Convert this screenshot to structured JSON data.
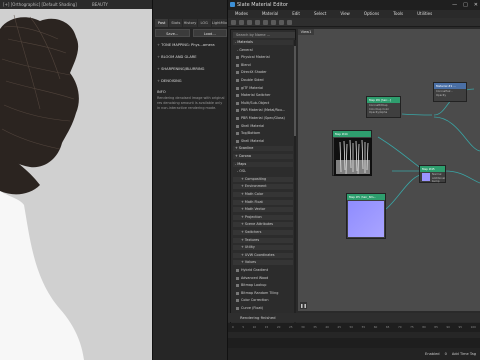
{
  "viewport": {
    "title_items": [
      "[+] [Orthographic] [Default Shading]",
      "BEAUTY"
    ]
  },
  "render_panel": {
    "tabs": [
      "Post",
      "Stats",
      "History",
      "LOG",
      "LightMix"
    ],
    "buttons": [
      "Save...",
      "Load..."
    ],
    "sections": [
      "TONE MAPPING: Phys...amera",
      "BLOOM AND GLARE",
      "SHARPENING/BLURRING",
      "DENOISING"
    ],
    "info_title": "INFO",
    "info_text": "Rendering denoised image with original res denoising amount is available only in non-interactive rendering mode."
  },
  "material_editor": {
    "title": "Slate Material Editor",
    "window_buttons": [
      "—",
      "□",
      "✕"
    ],
    "menu": [
      "Modes",
      "Material",
      "Edit",
      "Select",
      "View",
      "Options",
      "Tools",
      "Utilities"
    ],
    "view_tab": "View1",
    "browser": {
      "search_placeholder": "Search by Name ...",
      "rows": [
        {
          "t": "cat",
          "label": "- Materials"
        },
        {
          "t": "sub",
          "label": "- General"
        },
        {
          "t": "item",
          "label": "Physical Material"
        },
        {
          "t": "item",
          "label": "Blend"
        },
        {
          "t": "item",
          "label": "DirectX Shader"
        },
        {
          "t": "item",
          "label": "Double Sided"
        },
        {
          "t": "item",
          "label": "glTF Material"
        },
        {
          "t": "item",
          "label": "Material Switcher"
        },
        {
          "t": "item",
          "label": "Multi/Sub-Object"
        },
        {
          "t": "item",
          "label": "PBR Material (Metal/Rou..."
        },
        {
          "t": "item",
          "label": "PBR Material (Spec/Gloss)"
        },
        {
          "t": "item",
          "label": "Shell Material"
        },
        {
          "t": "item",
          "label": "Top/Bottom"
        },
        {
          "t": "item",
          "label": "Shell Material"
        },
        {
          "t": "cat",
          "label": "+ Scanline"
        },
        {
          "t": "cat",
          "label": "+ Corona"
        },
        {
          "t": "cat",
          "label": "- Maps"
        },
        {
          "t": "sub",
          "label": "- OSL"
        },
        {
          "t": "sub2",
          "label": "+ Compositing"
        },
        {
          "t": "sub2",
          "label": "+ Environment"
        },
        {
          "t": "sub2",
          "label": "+ Math Color"
        },
        {
          "t": "sub2",
          "label": "+ Math Float"
        },
        {
          "t": "sub2",
          "label": "+ Math Vector"
        },
        {
          "t": "sub2",
          "label": "+ Projection"
        },
        {
          "t": "sub2",
          "label": "+ Scene Attributes"
        },
        {
          "t": "sub2",
          "label": "+ Switchers"
        },
        {
          "t": "sub2",
          "label": "+ Textures"
        },
        {
          "t": "sub2",
          "label": "+ Utility"
        },
        {
          "t": "sub2",
          "label": "+ UVW Coordinates"
        },
        {
          "t": "sub2",
          "label": "+ Values"
        },
        {
          "t": "item",
          "label": "Hybrid Gradient"
        },
        {
          "t": "item",
          "label": "Advanced Wood"
        },
        {
          "t": "item",
          "label": "Bitmap Lookup"
        },
        {
          "t": "item",
          "label": "Bitmap Random Tiling"
        },
        {
          "t": "item",
          "label": "Color Correction"
        },
        {
          "t": "item",
          "label": "Curve (Float)"
        }
      ]
    },
    "nodes": [
      {
        "id": "n1",
        "header": "Map #6 [hair...]",
        "sub": "CoronaBitmap",
        "lines": [
          "Colormap Color",
          "Opacity/Alpha",
          "Translucency"
        ],
        "color": "#2e9e6e"
      },
      {
        "id": "n2",
        "header": "Material #1 ...",
        "sub": "CoronaHair...",
        "lines": [
          "Opacity"
        ],
        "color": "#4a6fa5"
      },
      {
        "id": "n3",
        "header": "Map #44",
        "sub": "Bitmap",
        "lines": [],
        "color": "#2e9e6e"
      },
      {
        "id": "n4",
        "header": "Map #45",
        "sub": "CoronaNormal",
        "lines": [
          "Normal",
          "Additional bump"
        ],
        "color": "#2e9e6e"
      },
      {
        "id": "n5",
        "header": "Map #5 (hair_Nm...",
        "sub": "Bitmap",
        "lines": [],
        "color": "#2e9e6e"
      }
    ],
    "status": "Rendering finished",
    "timeline_ticks": [
      "0",
      "5",
      "10",
      "15",
      "20",
      "25",
      "30",
      "35",
      "40",
      "45",
      "50",
      "55",
      "60",
      "65",
      "70",
      "75",
      "80",
      "85",
      "90",
      "95",
      "100"
    ],
    "bottom_right": [
      "Enabled",
      "0",
      "Add Time Tag"
    ]
  }
}
